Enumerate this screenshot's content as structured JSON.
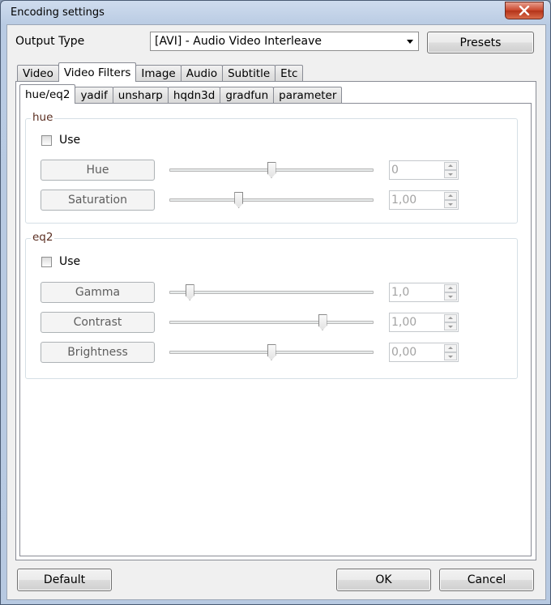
{
  "window": {
    "title": "Encoding settings"
  },
  "output_type": {
    "label": "Output Type",
    "value": "[AVI] - Audio Video Interleave",
    "presets_label": "Presets"
  },
  "main_tabs": [
    "Video",
    "Video Filters",
    "Image",
    "Audio",
    "Subtitle",
    "Etc"
  ],
  "sub_tabs": [
    "hue/eq2",
    "yadif",
    "unsharp",
    "hqdn3d",
    "gradfun",
    "parameter"
  ],
  "hue": {
    "title": "hue",
    "use_label": "Use",
    "rows": [
      {
        "label": "Hue",
        "value": "0",
        "slider_level": 0.5
      },
      {
        "label": "Saturation",
        "value": "1,00",
        "slider_level": 0.34
      }
    ]
  },
  "eq2": {
    "title": "eq2",
    "use_label": "Use",
    "rows": [
      {
        "label": "Gamma",
        "value": "1,0",
        "slider_level": 0.1
      },
      {
        "label": "Contrast",
        "value": "1,00",
        "slider_level": 0.75
      },
      {
        "label": "Brightness",
        "value": "0,00",
        "slider_level": 0.5
      }
    ]
  },
  "footer": {
    "default_label": "Default",
    "ok_label": "OK",
    "cancel_label": "Cancel"
  }
}
